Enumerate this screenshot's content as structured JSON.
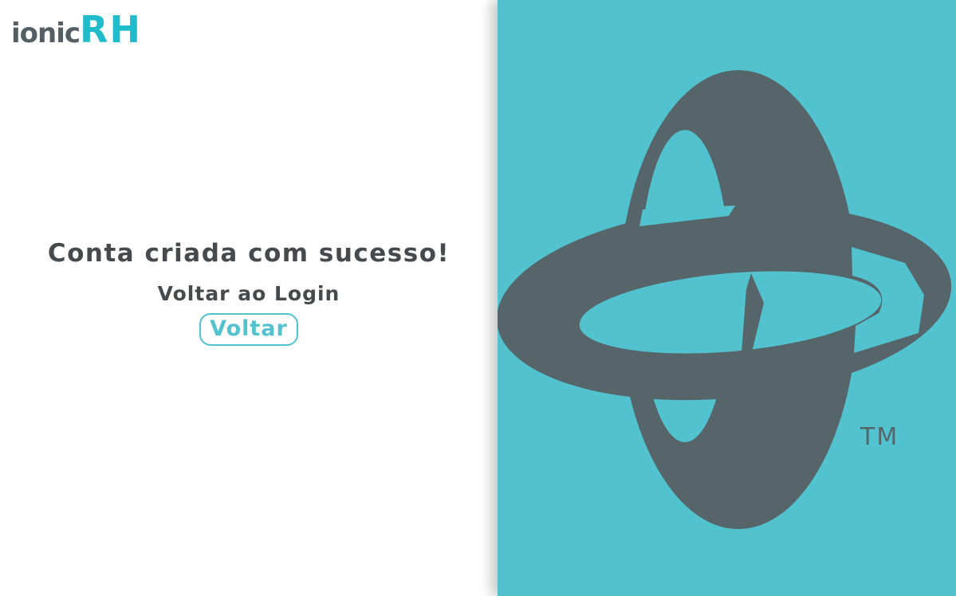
{
  "brand": {
    "logo_prefix": "ionic",
    "logo_suffix": "RH",
    "trademark": "TM"
  },
  "main": {
    "title": "Conta criada com sucesso!",
    "subtitle": "Voltar ao Login",
    "back_button_label": "Voltar"
  },
  "colors": {
    "accent": "#52c2ce",
    "brand_dark": "#566569",
    "text": "#474a4c"
  },
  "icons": {
    "brand_mark": "ionic-orbit-logo-icon"
  }
}
